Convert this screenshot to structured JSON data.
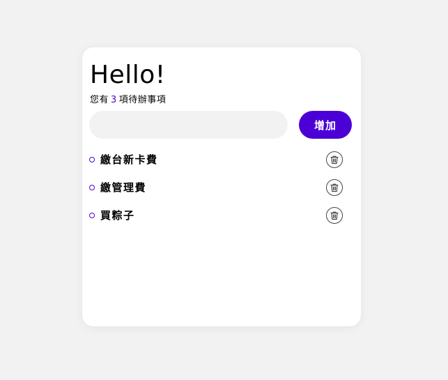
{
  "header": {
    "title": "Hello!",
    "subtitle_prefix": "您有",
    "pending_count": "3",
    "subtitle_suffix": "項待辦事項"
  },
  "input": {
    "value": "",
    "placeholder": ""
  },
  "add_button": {
    "label": "增加"
  },
  "todos": [
    {
      "label": "繳台新卡費",
      "icon": "trash-icon"
    },
    {
      "label": "繳管理費",
      "icon": "trash-icon"
    },
    {
      "label": "買粽子",
      "icon": "trash-icon"
    }
  ],
  "colors": {
    "accent": "#4b00d6",
    "page_background": "#f2f2f2",
    "card_background": "#ffffff"
  }
}
